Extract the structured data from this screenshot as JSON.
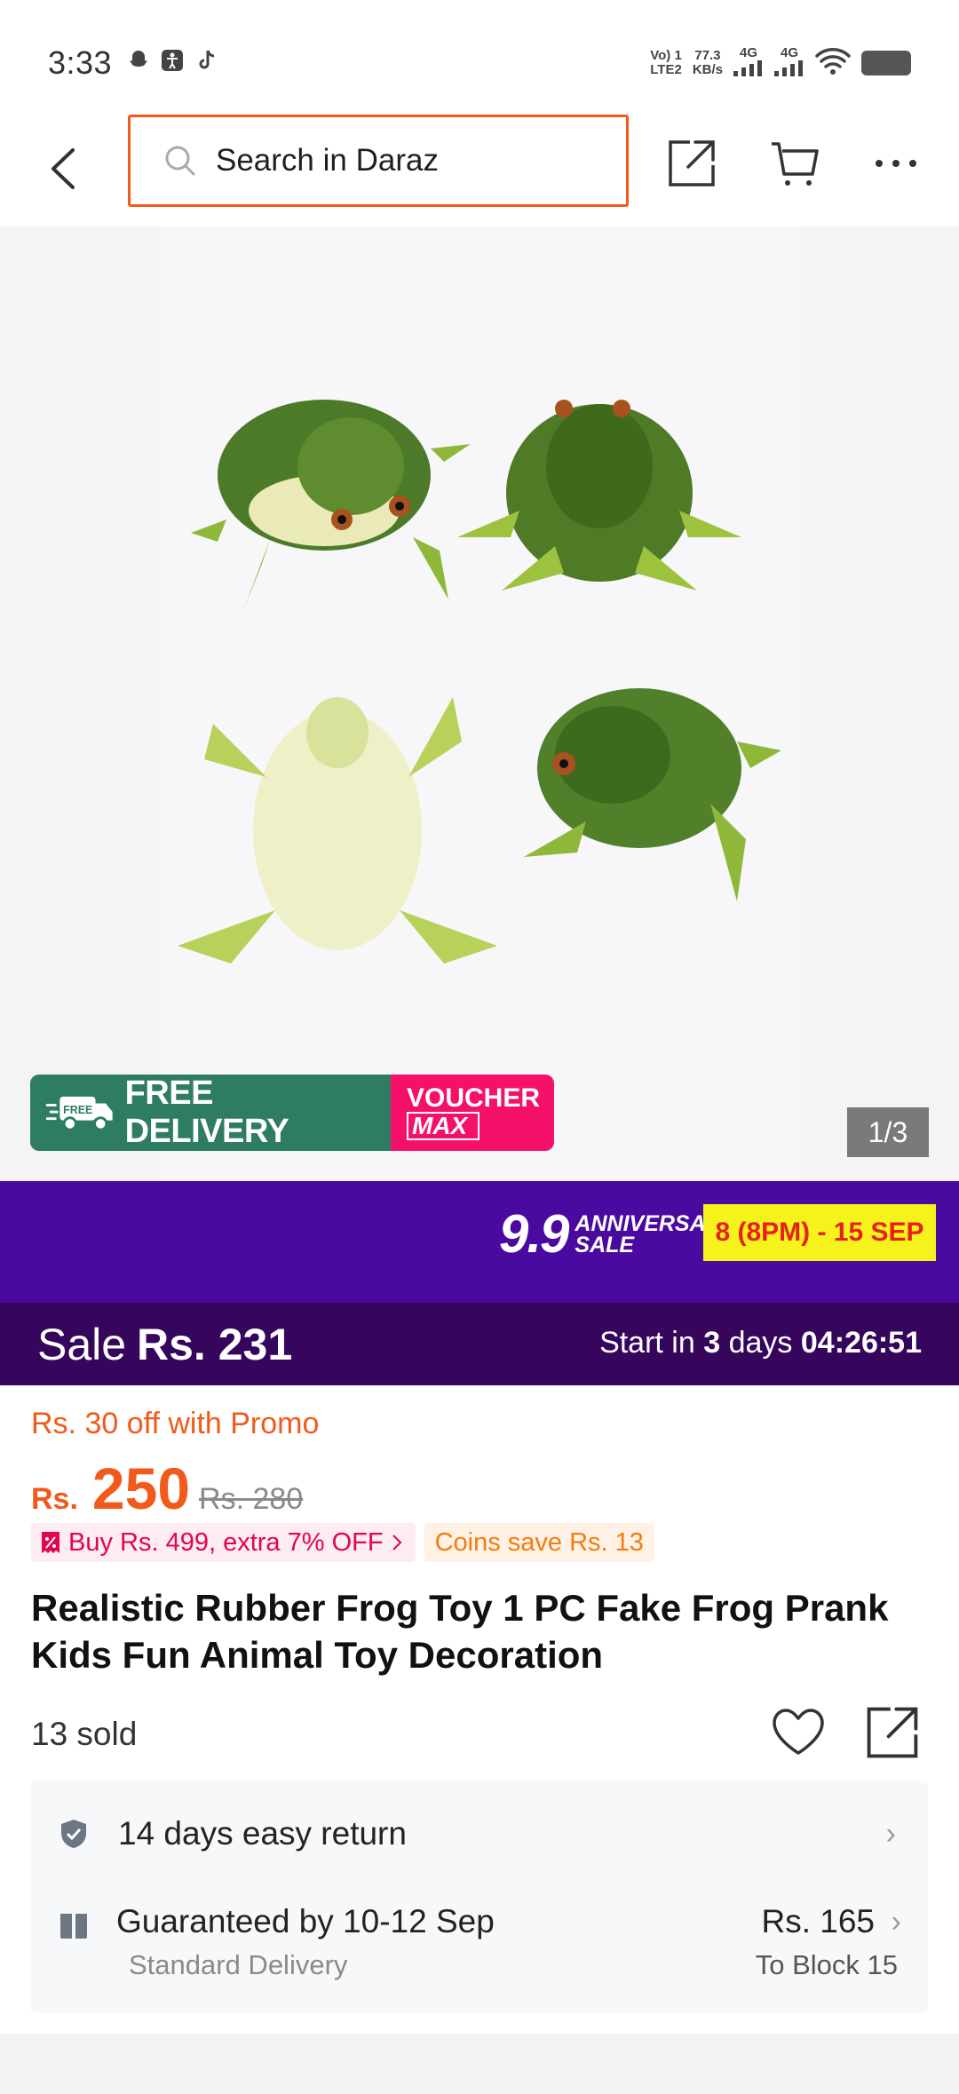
{
  "status_bar": {
    "time": "3:33",
    "net1_top": "Vo) 1",
    "net1_bottom": "LTE2",
    "speed_top": "77.3",
    "speed_bottom": "KB/s",
    "sig1": "4G",
    "sig2": "4G"
  },
  "top_bar": {
    "search_placeholder": "Search in Daraz",
    "icons": [
      "back-icon",
      "search-icon",
      "share-icon",
      "cart-icon",
      "more-icon"
    ]
  },
  "gallery": {
    "counter": "1/3",
    "badge_delivery": "FREE DELIVERY",
    "badge_free_small": "FREE",
    "badge_voucher": "VOUCHER",
    "badge_max": "MAX"
  },
  "campaign": {
    "logo_big": "9.9",
    "logo_line1": "ANNIVERSARY",
    "logo_line2": "SALE",
    "dates": "8 (8PM) - 15 SEP"
  },
  "sale": {
    "label": "Sale",
    "price": "Rs. 231",
    "countdown_prefix": "Start in",
    "countdown_days": "3",
    "countdown_days_word": "days",
    "countdown_time": "04:26:51"
  },
  "product": {
    "promo": "Rs. 30 off with Promo",
    "currency": "Rs.",
    "price": "250",
    "old_price": "Rs. 280",
    "tag_bundle": "Buy Rs. 499, extra 7% OFF",
    "tag_coins": "Coins save Rs. 13",
    "title": "Realistic Rubber Frog Toy 1 PC Fake Frog Prank Kids Fun Animal Toy Decoration",
    "sold": "13 sold"
  },
  "delivery": {
    "return_label": "14 days easy return",
    "guarantee_label": "Guaranteed by 10-12 Sep",
    "method": "Standard Delivery",
    "fee": "Rs. 165",
    "location": "To Block 15"
  },
  "colors": {
    "accent": "#f05a1a",
    "campaign_bg": "#4a0aa0",
    "sale_bg": "#36065c",
    "delivery_green": "#2e7c63",
    "voucher_pink": "#f5106a"
  }
}
